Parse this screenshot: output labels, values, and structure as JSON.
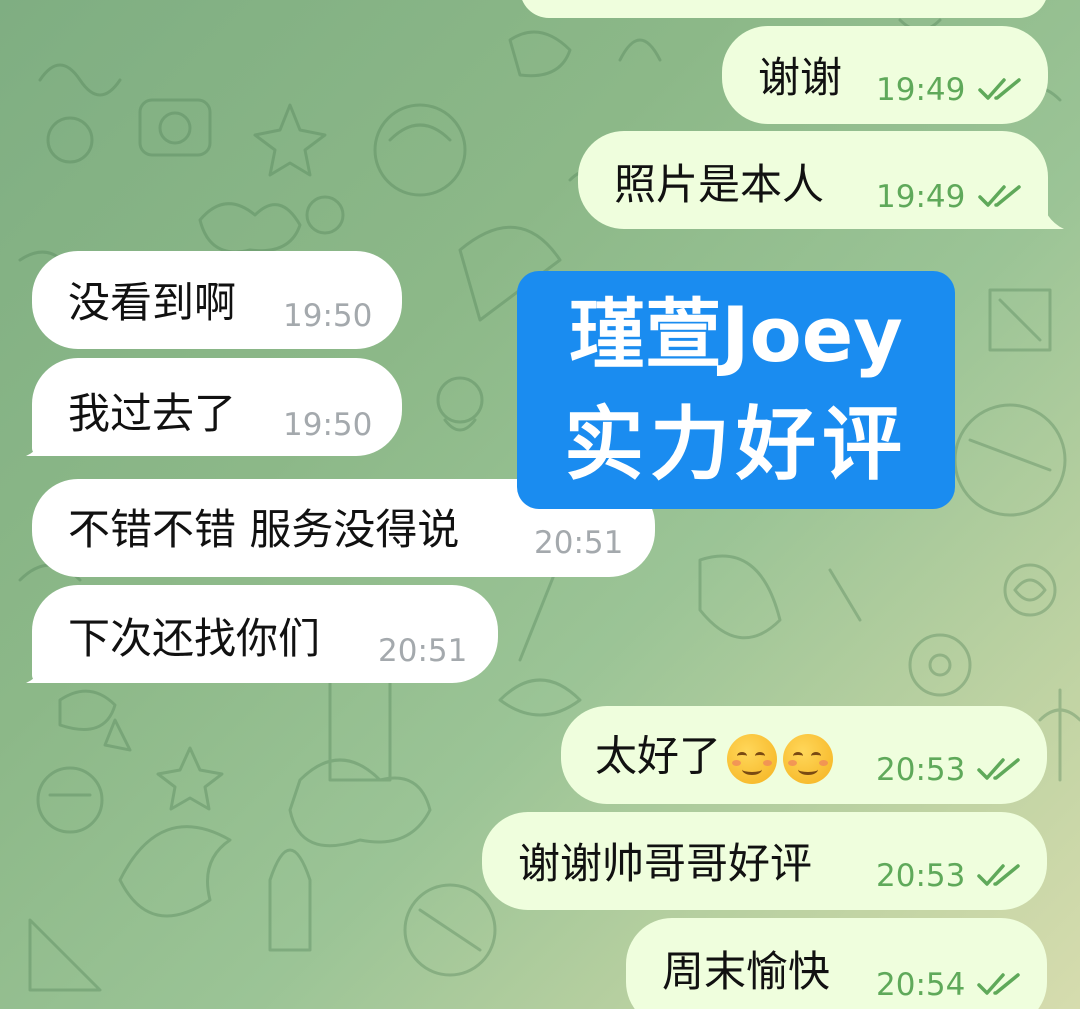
{
  "messages": [
    {
      "id": "m1",
      "direction": "out",
      "text": "谢谢",
      "time": "19:49",
      "status": "read"
    },
    {
      "id": "m2",
      "direction": "out",
      "text": "照片是本人",
      "time": "19:49",
      "status": "read"
    },
    {
      "id": "m3",
      "direction": "in",
      "text": "没看到啊",
      "time": "19:50"
    },
    {
      "id": "m4",
      "direction": "in",
      "text": "我过去了",
      "time": "19:50"
    },
    {
      "id": "m5",
      "direction": "in",
      "text": "不错不错 服务没得说",
      "time": "20:51"
    },
    {
      "id": "m6",
      "direction": "in",
      "text": "下次还找你们",
      "time": "20:51"
    },
    {
      "id": "m7",
      "direction": "out",
      "text": "太好了",
      "emoji": [
        "smiling-face-emoji",
        "smiling-face-emoji"
      ],
      "time": "20:53",
      "status": "read"
    },
    {
      "id": "m8",
      "direction": "out",
      "text": "谢谢帅哥哥好评",
      "time": "20:53",
      "status": "read"
    },
    {
      "id": "m9",
      "direction": "out",
      "text": "周末愉快",
      "time": "20:54",
      "status": "read"
    }
  ],
  "badge": {
    "line1": "瑾萱Joey",
    "line2": "实力好评",
    "color": "#1a8cf0"
  },
  "colors": {
    "incoming_bubble": "#ffffff",
    "outgoing_bubble": "#effedd",
    "read_check": "#5fa95a",
    "incoming_time": "#a4a9ad"
  },
  "icons": {
    "read_status": "double-check-icon"
  }
}
